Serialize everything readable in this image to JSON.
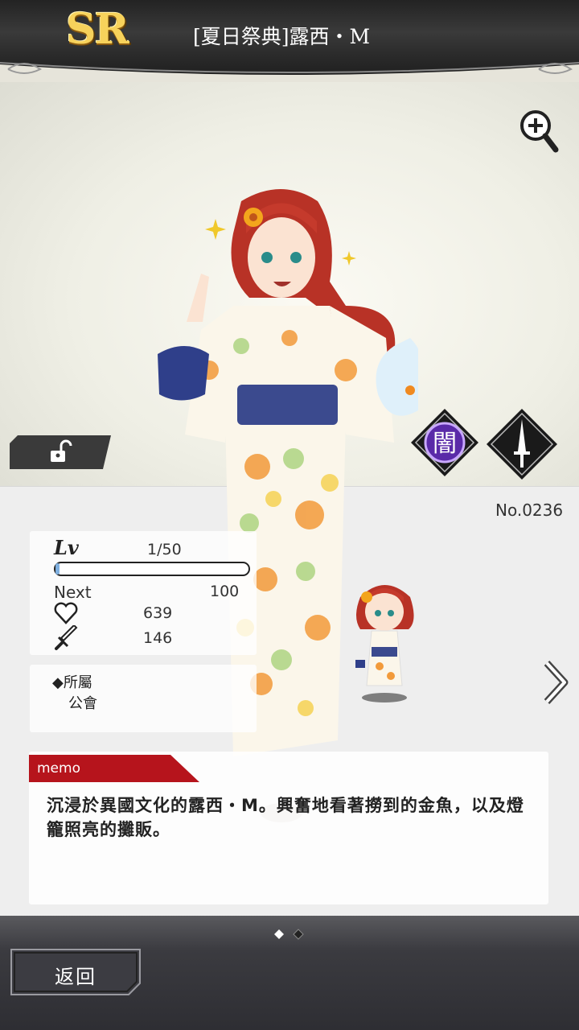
{
  "header": {
    "rarity": "SR",
    "title": "[夏日祭典]露西・M"
  },
  "card": {
    "number": "No.0236",
    "attribute_icon": "dark-attribute-icon",
    "attribute_label": "闇",
    "weapon_icon": "sword-icon",
    "lock_icon": "unlock-icon"
  },
  "stats": {
    "level_label": "Lv",
    "level": "1/50",
    "exp_progress": 0.02,
    "next_label": "Next",
    "next": "100",
    "hp_icon": "heart-icon",
    "hp": "639",
    "atk_icon": "sword-icon",
    "atk": "146"
  },
  "affiliation": {
    "label": "◆所屬",
    "value": "公會"
  },
  "memo": {
    "label": "memo",
    "text": "沉浸於異國文化的露西・M。興奮地看著撈到的金魚，以及燈籠照亮的攤販。"
  },
  "pager": {
    "current": 1,
    "total": 2
  },
  "footer": {
    "back_label": "返回"
  },
  "colors": {
    "memo_tab": "#b6141c",
    "rarity_gold": "#f7d25b",
    "header_bg": "#2a2a2a"
  }
}
